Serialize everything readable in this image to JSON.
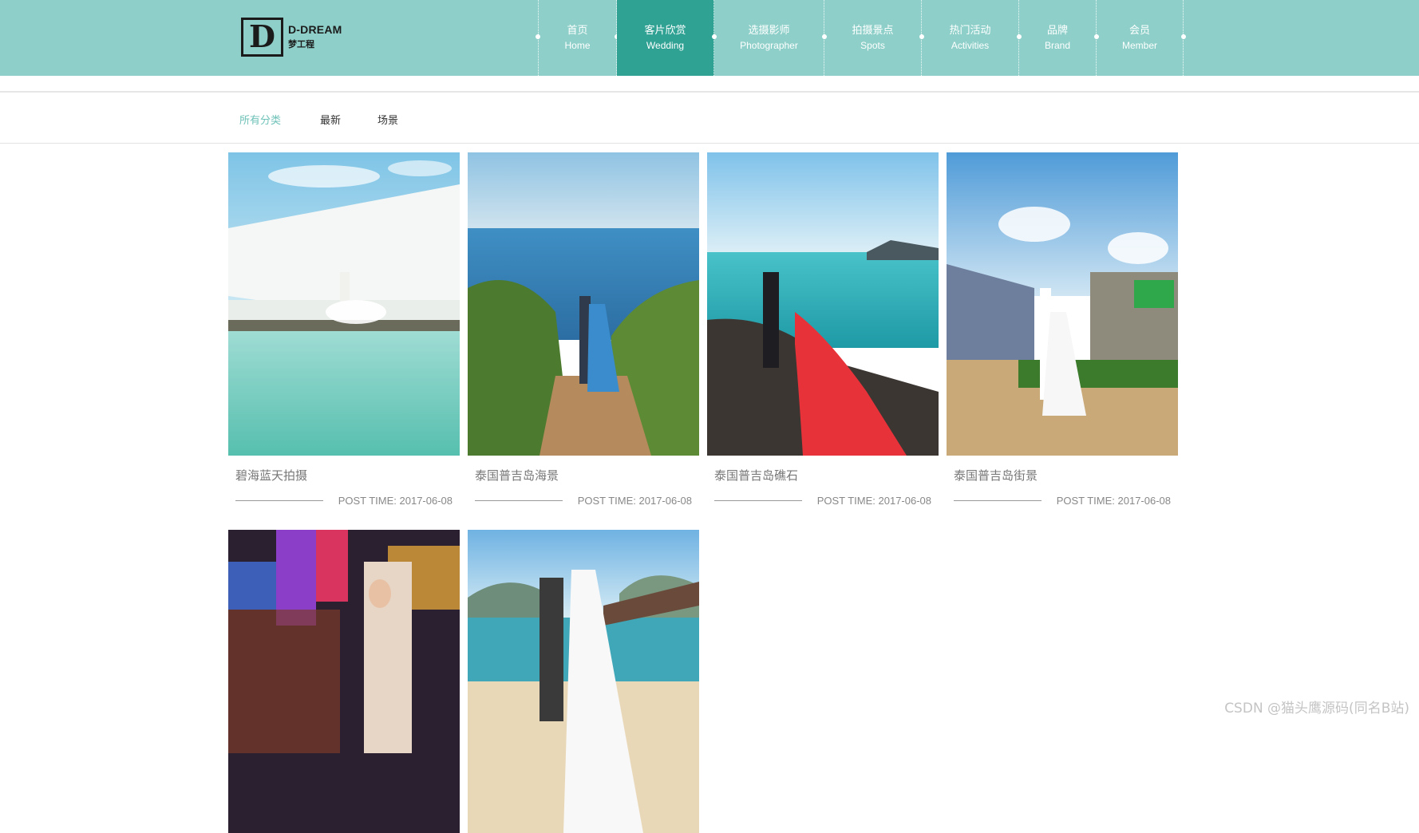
{
  "brand": {
    "logo_letter": "D",
    "name_en": "D-DREAM",
    "name_cn": "梦工程"
  },
  "nav": [
    {
      "cn": "首页",
      "en": "Home",
      "active": false
    },
    {
      "cn": "客片欣赏",
      "en": "Wedding",
      "active": true
    },
    {
      "cn": "选摄影师",
      "en": "Photographer",
      "active": false
    },
    {
      "cn": "拍摄景点",
      "en": "Spots",
      "active": false
    },
    {
      "cn": "热门活动",
      "en": "Activities",
      "active": false
    },
    {
      "cn": "品牌",
      "en": "Brand",
      "active": false
    },
    {
      "cn": "会员",
      "en": "Member",
      "active": false
    }
  ],
  "categories": [
    {
      "label": "所有分类",
      "active": true
    },
    {
      "label": "最新",
      "active": false
    },
    {
      "label": "场景",
      "active": false
    }
  ],
  "gallery": [
    {
      "title": "碧海蓝天拍摄",
      "post": "POST TIME: 2017-06-08"
    },
    {
      "title": "泰国普吉岛海景",
      "post": "POST TIME: 2017-06-08"
    },
    {
      "title": "泰国普吉岛礁石",
      "post": "POST TIME: 2017-06-08"
    },
    {
      "title": "泰国普吉岛街景",
      "post": "POST TIME: 2017-06-08"
    },
    {
      "title": "",
      "post": ""
    },
    {
      "title": "",
      "post": ""
    }
  ],
  "colors": {
    "header_bg": "#8ed0c9",
    "nav_active_bg": "#2fa294",
    "category_active": "#6fc2b8"
  },
  "watermark": "CSDN @猫头鹰源码(同名B站)"
}
